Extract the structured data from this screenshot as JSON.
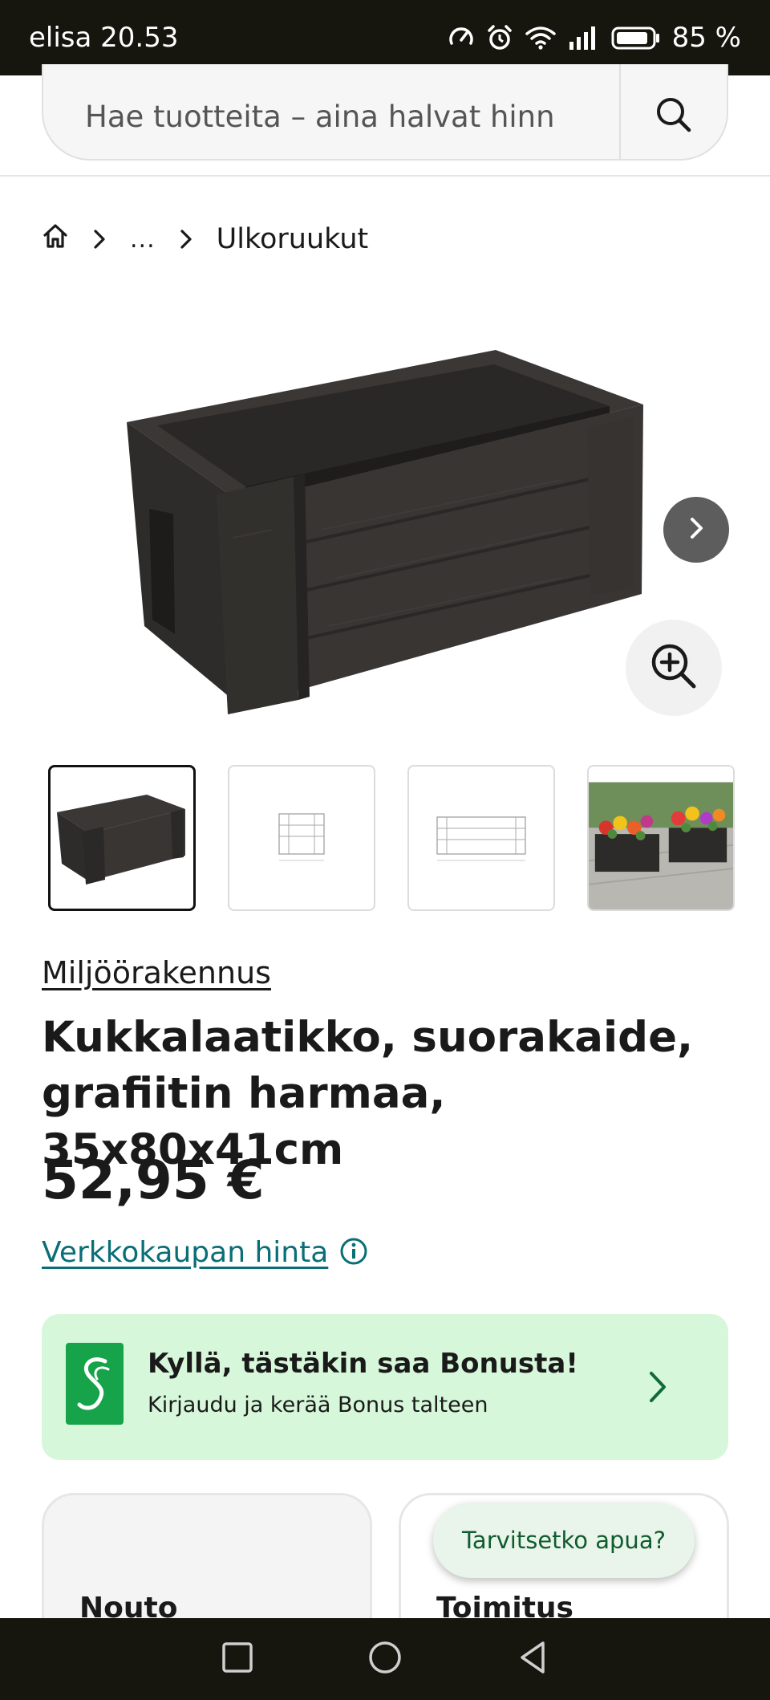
{
  "status_bar": {
    "carrier_time": "elisa 20.53",
    "battery": "85 %"
  },
  "search": {
    "placeholder": "Hae tuotteita – aina halvat hinn"
  },
  "breadcrumb": {
    "ellipsis": "...",
    "current": "Ulkoruukut"
  },
  "product": {
    "brand": "Miljöörakennus",
    "title": "Kukkalaatikko, suorakaide, grafiitin harmaa, 35x80x41cm",
    "price": "52,95 €",
    "online_price_label": "Verkkokaupan hinta"
  },
  "bonus_banner": {
    "title": "Kyllä, tästäkin saa Bonusta!",
    "subtitle": "Kirjaudu ja kerää Bonus talteen"
  },
  "cards": {
    "pickup_title": "Nouto",
    "delivery_title": "Toimitus"
  },
  "help_button": {
    "label": "Tarvitsetko apua?"
  },
  "colors": {
    "accent_teal": "#0a6e76",
    "bonus_green": "#16a34a",
    "bonus_bg": "#d7f7da"
  }
}
